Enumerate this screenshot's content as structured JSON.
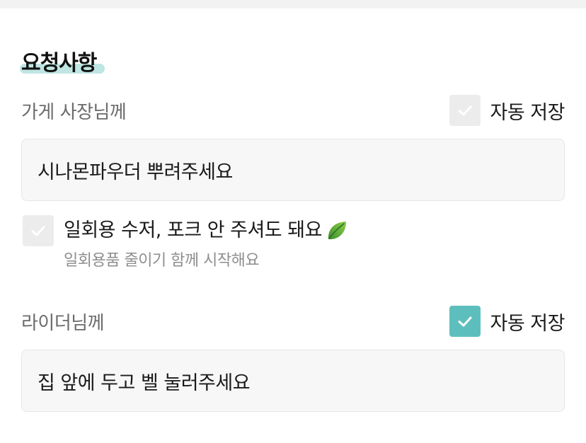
{
  "section": {
    "title": "요청사항"
  },
  "store": {
    "label": "가게 사장님께",
    "autosave_label": "자동 저장",
    "autosave_checked": false,
    "request_value": "시나몬파우더 뿌려주세요"
  },
  "utensils": {
    "label": "일회용 수저, 포크 안 주셔도 돼요",
    "sublabel": "일회용품 줄이기 함께 시작해요",
    "checked": false,
    "icon": "leaf-icon"
  },
  "rider": {
    "label": "라이더님께",
    "autosave_label": "자동 저장",
    "autosave_checked": true,
    "request_value": "집 앞에 두고 벨 눌러주세요"
  },
  "colors": {
    "accent": "#5dbfbd",
    "title_highlight": "#bfe6e3",
    "unchecked_box": "#ececec"
  }
}
